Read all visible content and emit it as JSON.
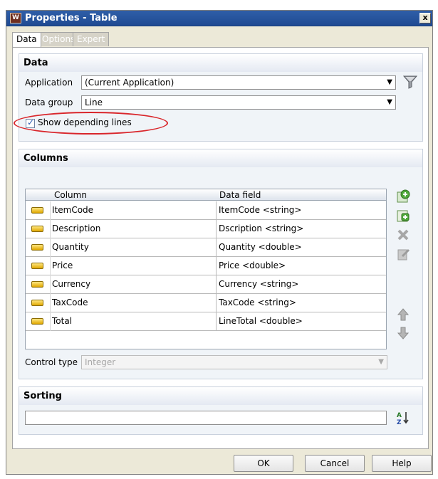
{
  "window": {
    "title": "Properties - Table",
    "close_label": "x"
  },
  "tabs": [
    {
      "label": "Data",
      "active": true
    },
    {
      "label": "Options",
      "active": false
    },
    {
      "label": "Expert",
      "active": false
    }
  ],
  "data_section": {
    "title": "Data",
    "application_label": "Application",
    "application_value": "(Current Application)",
    "data_group_label": "Data group",
    "data_group_value": "Line",
    "show_depending_label": "Show depending lines",
    "show_depending_checked": true
  },
  "columns_section": {
    "title": "Columns",
    "headers": {
      "column": "Column",
      "data_field": "Data field"
    },
    "rows": [
      {
        "column": "ItemCode",
        "data_field": "ItemCode <string>"
      },
      {
        "column": "Description",
        "data_field": "Dscription <string>"
      },
      {
        "column": "Quantity",
        "data_field": "Quantity <double>"
      },
      {
        "column": "Price",
        "data_field": "Price <double>"
      },
      {
        "column": "Currency",
        "data_field": "Currency <string>"
      },
      {
        "column": "TaxCode",
        "data_field": "TaxCode <string>"
      },
      {
        "column": "Total",
        "data_field": "LineTotal <double>"
      }
    ],
    "control_type_label": "Control type",
    "control_type_value": "Integer"
  },
  "sorting_section": {
    "title": "Sorting",
    "value": ""
  },
  "footer": {
    "ok_label": "OK",
    "cancel_label": "Cancel",
    "help_label": "Help"
  },
  "colors": {
    "title_bar": "#2f5ea8",
    "highlight": "#d9262b",
    "section_bg": "#f0f4f8"
  }
}
